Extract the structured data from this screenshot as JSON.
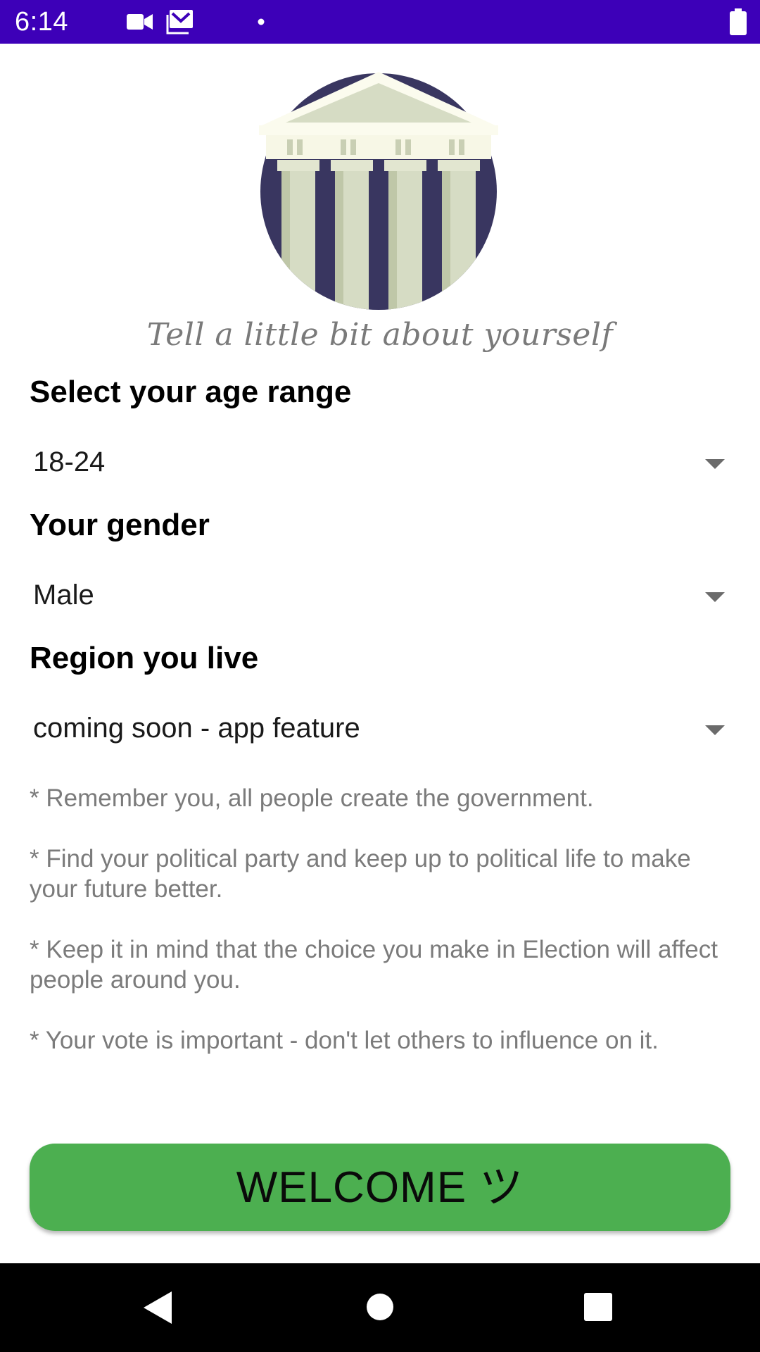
{
  "status_bar": {
    "time": "6:14",
    "icons": [
      "video-camera-icon",
      "mail-icon",
      "dot-icon",
      "battery-icon"
    ],
    "background": "#3d00b8"
  },
  "logo": {
    "icon": "parthenon-columns-icon",
    "circle_color": "#393660",
    "column_color": "#d6dcc4"
  },
  "tagline": "Tell a little bit about yourself",
  "age": {
    "label": "Select your age range",
    "value": "18-24"
  },
  "gender": {
    "label": "Your gender",
    "value": "Male"
  },
  "region": {
    "label": "Region you live",
    "value": "coming soon - app feature"
  },
  "notes": [
    "* Remember you, all people create the government.",
    " * Find your political party and keep up to political life to make your future better.",
    " * Keep it in mind that the choice you make in Election will affect people around you.",
    " * Your vote is important - don't let others to influence on it."
  ],
  "welcome_button": {
    "label": "WELCOME ツ",
    "color": "#4caf50"
  },
  "nav_bar": {
    "icons": [
      "back-icon",
      "home-icon",
      "recents-icon"
    ]
  }
}
